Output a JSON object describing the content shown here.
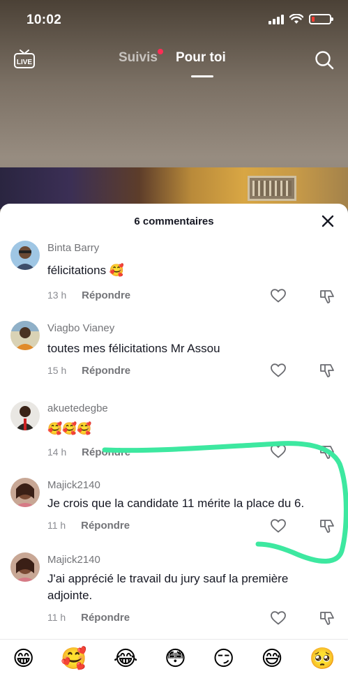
{
  "status_bar": {
    "time": "10:02",
    "battery_level": 0.15
  },
  "nav": {
    "following": "Suivis",
    "for_you": "Pour toi",
    "live_label": "LIVE"
  },
  "comments_panel": {
    "title": "6 commentaires",
    "comments": [
      {
        "user": "Binta Barry",
        "text": "félicitations 🥰",
        "time": "13 h",
        "reply": "Répondre"
      },
      {
        "user": "Viagbo Vianey",
        "text": "toutes mes félicitations Mr Assou",
        "time": "15 h",
        "reply": "Répondre"
      },
      {
        "user": "akuetedegbe",
        "text": "🥰🥰🥰",
        "time": "14 h",
        "reply": "Répondre"
      },
      {
        "user": "Majick2140",
        "text": "Je crois que la candidate 11 mérite la place du 6.",
        "time": "11 h",
        "reply": "Répondre"
      },
      {
        "user": "Majick2140",
        "text": "J'ai apprécié le travail du jury sauf la première adjointe.",
        "time": "11 h",
        "reply": "Répondre"
      }
    ]
  },
  "emoji_bar": [
    "😁",
    "🥰",
    "😂",
    "😳",
    "😏",
    "😅",
    "🥺"
  ],
  "colors": {
    "annotation_stroke": "#3de8a0",
    "accent_dot": "#ff2d55",
    "battery": "#ff3b30"
  }
}
